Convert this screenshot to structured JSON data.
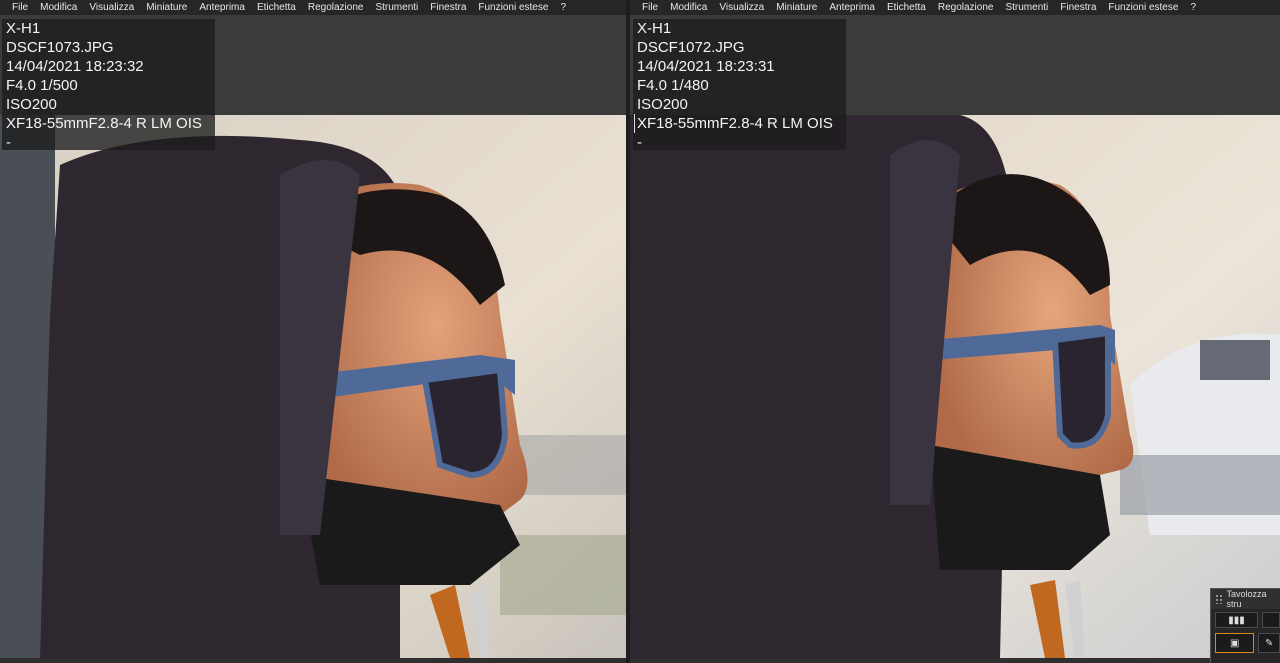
{
  "menu": [
    "File",
    "Modifica",
    "Visualizza",
    "Miniature",
    "Anteprima",
    "Etichetta",
    "Regolazione",
    "Strumenti",
    "Finestra",
    "Funzioni estese",
    "?"
  ],
  "left_viewer": {
    "camera": "X-H1",
    "filename": "DSCF1073.JPG",
    "datetime": "14/04/2021 18:23:32",
    "exposure": "F4.0 1/500",
    "iso": "ISO200",
    "lens": "XF18-55mmF2.8-4 R LM OIS",
    "extra": "-"
  },
  "right_viewer": {
    "camera": "X-H1",
    "filename": "DSCF1072.JPG",
    "datetime": "14/04/2021 18:23:31",
    "exposure": "F4.0 1/480",
    "iso": "ISO200",
    "lens": "XF18-55mmF2.8-4 R LM OIS",
    "extra": "-"
  },
  "palette": {
    "title": "Tavolozza stru"
  }
}
